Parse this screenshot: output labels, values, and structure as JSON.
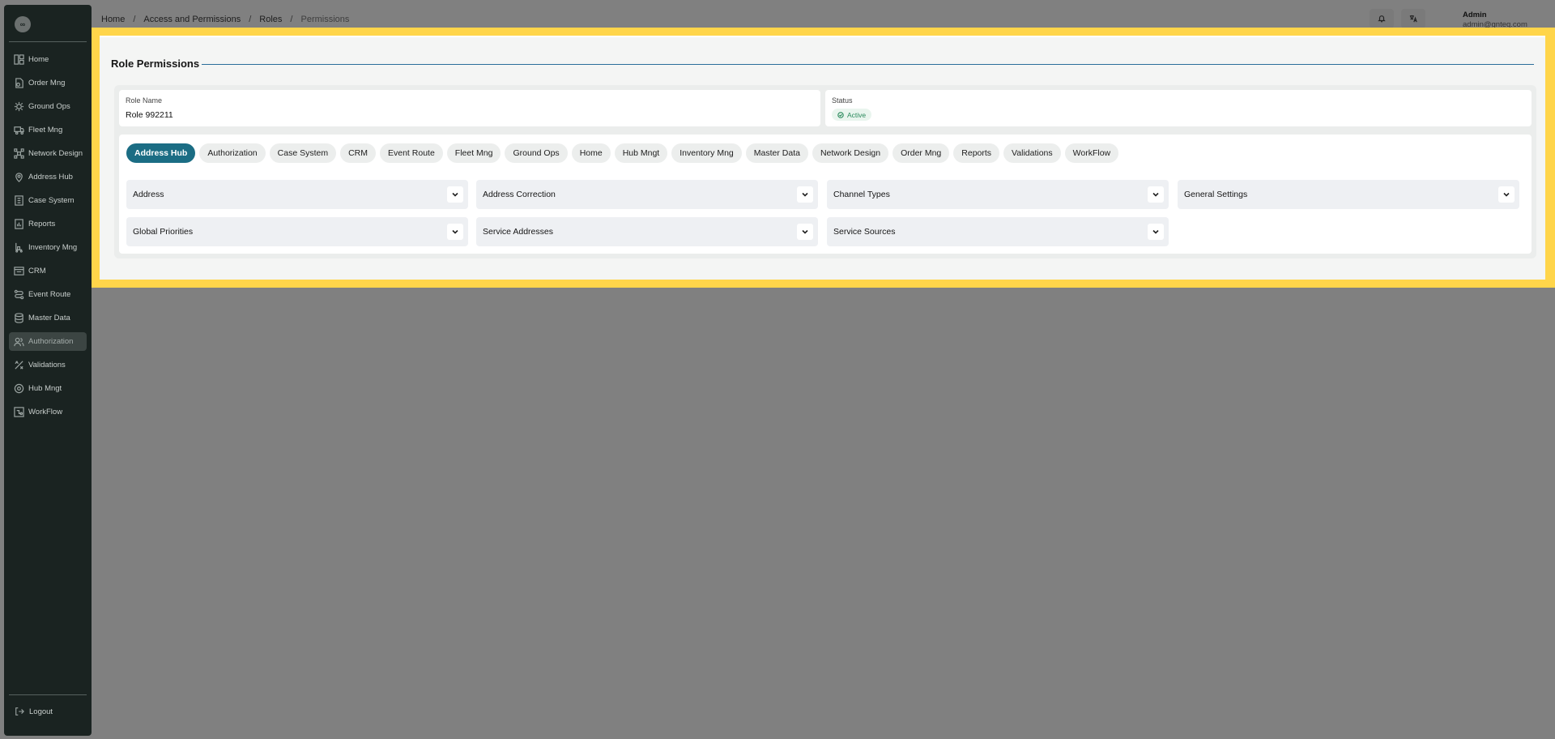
{
  "sidebar": {
    "logo": "∞",
    "items": [
      {
        "label": "Home",
        "icon": "home-icon"
      },
      {
        "label": "Order Mng",
        "icon": "order-icon"
      },
      {
        "label": "Ground Ops",
        "icon": "ground-ops-icon"
      },
      {
        "label": "Fleet Mng",
        "icon": "truck-icon"
      },
      {
        "label": "Network Design",
        "icon": "network-icon"
      },
      {
        "label": "Address Hub",
        "icon": "location-icon"
      },
      {
        "label": "Case System",
        "icon": "case-icon"
      },
      {
        "label": "Reports",
        "icon": "reports-icon"
      },
      {
        "label": "Inventory Mng",
        "icon": "inventory-icon"
      },
      {
        "label": "CRM",
        "icon": "crm-icon"
      },
      {
        "label": "Event Route",
        "icon": "route-icon"
      },
      {
        "label": "Master Data",
        "icon": "database-icon"
      },
      {
        "label": "Authorization",
        "icon": "users-icon"
      },
      {
        "label": "Validations",
        "icon": "validations-icon"
      },
      {
        "label": "Hub Mngt",
        "icon": "hub-icon"
      },
      {
        "label": "WorkFlow",
        "icon": "workflow-icon"
      }
    ],
    "active": "Authorization",
    "logout": "Logout"
  },
  "breadcrumb": [
    "Home",
    "Access and Permissions",
    "Roles",
    "Permissions"
  ],
  "header": {
    "user_name": "Admin",
    "user_email": "admin@gnteq.com"
  },
  "page": {
    "title": "Role Permissions",
    "role_name_label": "Role Name",
    "role_name_value": "Role 992211",
    "status_label": "Status",
    "status_value": "Active"
  },
  "tabs": [
    "Address Hub",
    "Authorization",
    "Case System",
    "CRM",
    "Event Route",
    "Fleet Mng",
    "Ground Ops",
    "Home",
    "Hub Mngt",
    "Inventory Mng",
    "Master Data",
    "Network Design",
    "Order Mng",
    "Reports",
    "Validations",
    "WorkFlow"
  ],
  "active_tab": "Address Hub",
  "accordions": [
    "Address",
    "Address Correction",
    "Channel Types",
    "General Settings",
    "Global Priorities",
    "Service Addresses",
    "Service Sources"
  ],
  "colors": {
    "highlight": "#ffd54a",
    "accent": "#1b6d84",
    "sidebar": "#1a2321",
    "status_green": "#2a8a5c"
  }
}
